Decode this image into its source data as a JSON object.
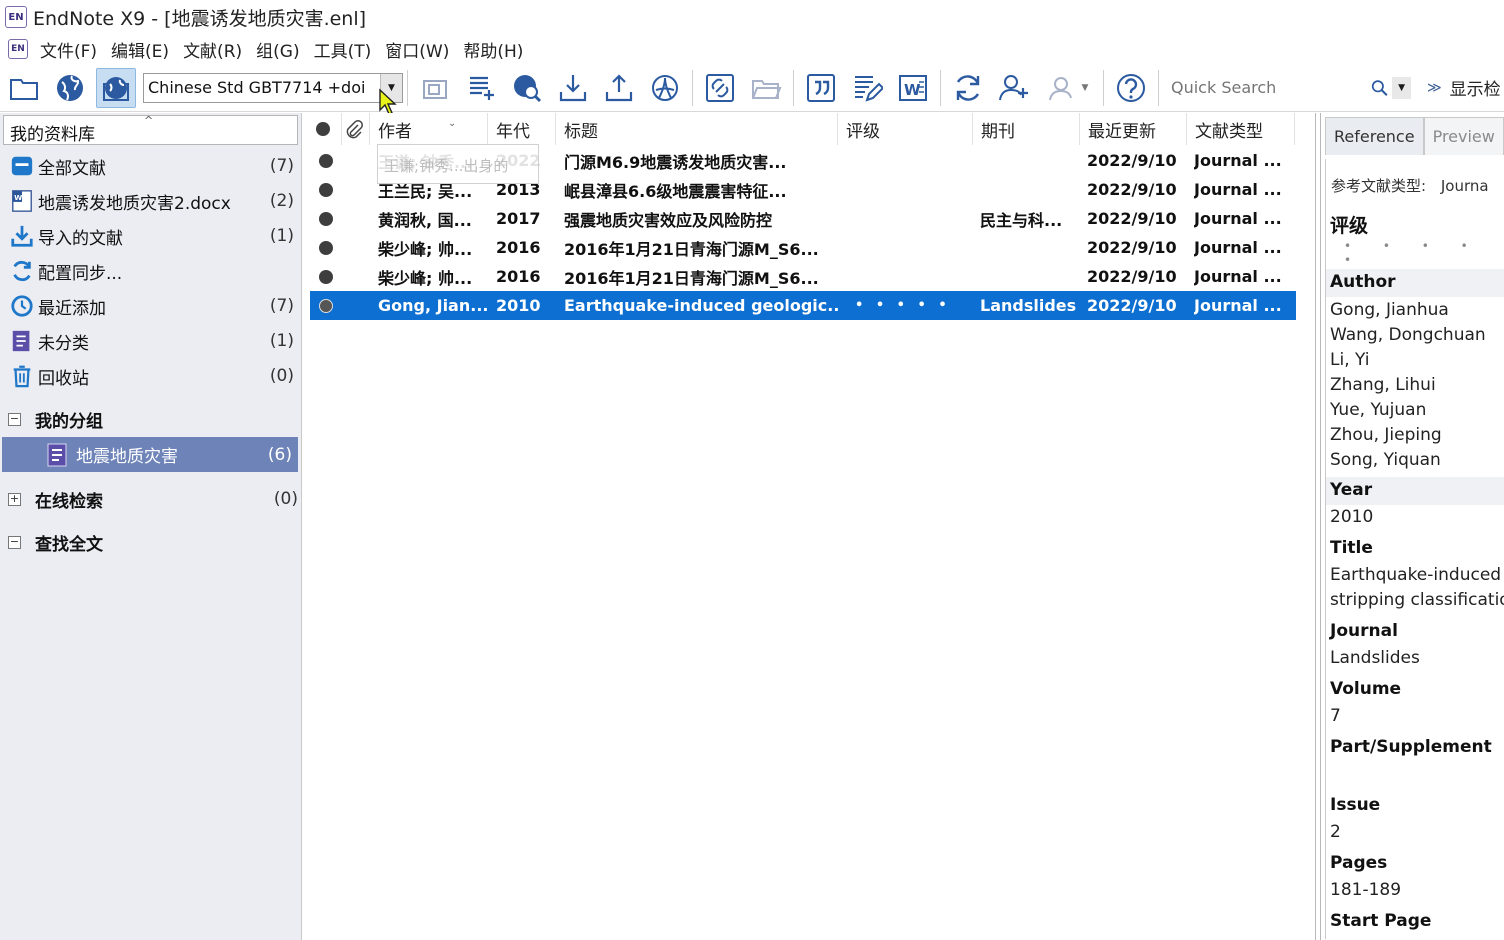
{
  "window": {
    "title": "EndNote X9 - [地震诱发地质灾害.enl]",
    "logo": "EN"
  },
  "menu": [
    "文件(F)",
    "编辑(E)",
    "文献(R)",
    "组(G)",
    "工具(T)",
    "窗口(W)",
    "帮助(H)"
  ],
  "toolbar": {
    "style_value": "Chinese Std GBT7714 +doi",
    "search_placeholder": "Quick Search",
    "show_more_label": "显示检"
  },
  "library": {
    "header": "我的资料库",
    "items": [
      {
        "label": "全部文献",
        "count": "(7)"
      },
      {
        "label": "地震诱发地质灾害2.docx",
        "count": "(2)"
      },
      {
        "label": "导入的文献",
        "count": "(1)"
      },
      {
        "label": "配置同步...",
        "count": ""
      },
      {
        "label": "最近添加",
        "count": "(7)"
      },
      {
        "label": "未分类",
        "count": "(1)"
      },
      {
        "label": "回收站",
        "count": "(0)"
      }
    ],
    "my_groups": {
      "label": "我的分组"
    },
    "group": {
      "label": "地震地质灾害",
      "count": "(6)"
    },
    "online": {
      "label": "在线检索",
      "count": "(0)"
    },
    "fulltext": {
      "label": "查找全文"
    }
  },
  "list": {
    "columns": [
      "作者",
      "年代",
      "标题",
      "评级",
      "期刊",
      "最近更新",
      "文献类型"
    ],
    "tooltip": "王谦;钟秀...出身的",
    "rows": [
      {
        "author": "王谦; 钟秀...",
        "year": "2022",
        "title": "门源M6.9地震诱发地质灾害...",
        "rating": "",
        "journal": "",
        "updated": "2022/9/10",
        "type": "Journal ..."
      },
      {
        "author": "王兰民; 吴...",
        "year": "2013",
        "title": "岷县漳县6.6级地震震害特征...",
        "rating": "",
        "journal": "",
        "updated": "2022/9/10",
        "type": "Journal ..."
      },
      {
        "author": "黄润秋, 国...",
        "year": "2017",
        "title": "强震地质灾害效应及风险防控",
        "rating": "",
        "journal": "民主与科...",
        "updated": "2022/9/10",
        "type": "Journal ..."
      },
      {
        "author": "柴少峰; 帅...",
        "year": "2016",
        "title": "2016年1月21日青海门源M_S6...",
        "rating": "",
        "journal": "",
        "updated": "2022/9/10",
        "type": "Journal ..."
      },
      {
        "author": "柴少峰; 帅...",
        "year": "2016",
        "title": "2016年1月21日青海门源M_S6...",
        "rating": "",
        "journal": "",
        "updated": "2022/9/10",
        "type": "Journal ..."
      },
      {
        "author": "Gong, Jian...",
        "year": "2010",
        "title": "Earthquake-induced geologic...",
        "rating": "• • • • •",
        "journal": "Landslides",
        "updated": "2022/9/10",
        "type": "Journal ...",
        "selected": true
      }
    ]
  },
  "reference": {
    "tabs": [
      "Reference",
      "Preview"
    ],
    "type_label": "参考文献类型:",
    "type_value": "Journa",
    "rating_label": "评级",
    "rating_dots": "• • • • •",
    "author_label": "Author",
    "authors": [
      "Gong, Jianhua",
      "Wang, Dongchuan",
      "Li, Yi",
      "Zhang, Lihui",
      "Yue, Yujuan",
      "Zhou, Jieping",
      "Song, Yiquan"
    ],
    "year_label": "Year",
    "year": "2010",
    "title_label": "Title",
    "title_line1": "Earthquake-induced g",
    "title_line2": "stripping classification",
    "journal_label": "Journal",
    "journal": "Landslides",
    "volume_label": "Volume",
    "volume": "7",
    "part_label": "Part/Supplement",
    "issue_label": "Issue",
    "issue": "2",
    "pages_label": "Pages",
    "pages": "181-189",
    "start_label": "Start Page"
  },
  "colors": {
    "selection": "#0c6fd1",
    "group_selected": "#6e84b9",
    "left_bg": "#ebedf3"
  }
}
